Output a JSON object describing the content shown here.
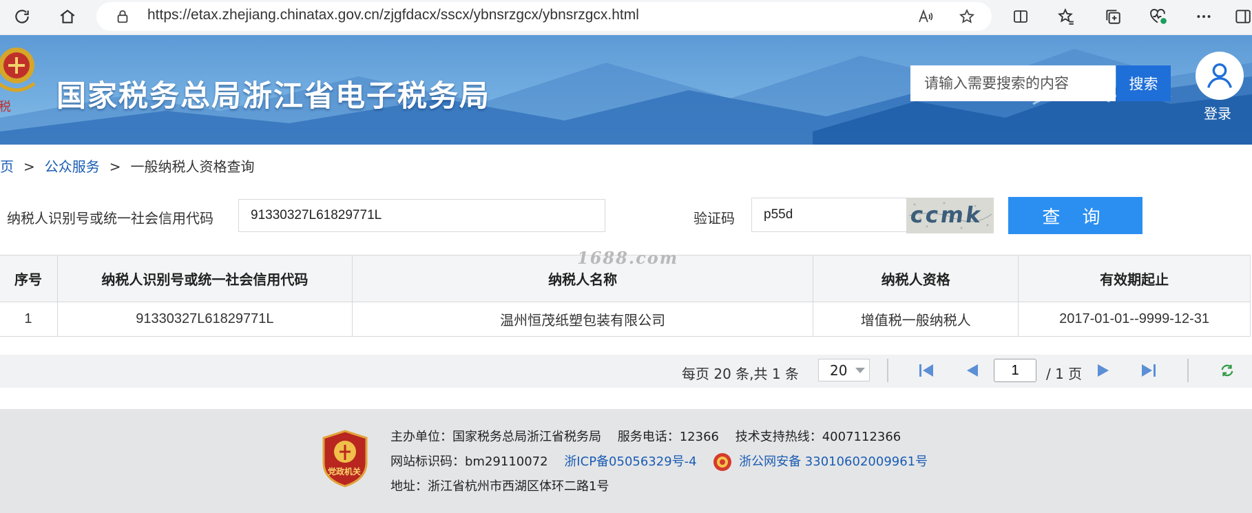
{
  "browser": {
    "url": "https://etax.zhejiang.chinatax.gov.cn/zjgfdacx/sscx/ybnsrzgcx/ybnsrzgcx.html"
  },
  "header": {
    "site_title": "国家税务总局浙江省电子税务局",
    "search_placeholder": "请输入需要搜索的内容",
    "search_button": "搜索",
    "login_label": "登录"
  },
  "breadcrumb": {
    "home": "首页",
    "separator": ">",
    "public_service": "公众服务",
    "current": "一般纳税人资格查询"
  },
  "query": {
    "taxpayer_id_label": "纳税人识别号或统一社会信用代码",
    "taxpayer_id_value": "91330327L61829771L",
    "captcha_label": "验证码",
    "captcha_value": "p55d",
    "captcha_image_text": "ccmk",
    "submit_button": "查 询"
  },
  "watermark": "1688.com",
  "table": {
    "columns": [
      "序号",
      "纳税人识别号或统一社会信用代码",
      "纳税人名称",
      "纳税人资格",
      "有效期起止"
    ],
    "rows": [
      [
        "1",
        "91330327L61829771L",
        "温州恒茂纸塑包装有限公司",
        "增值税一般纳税人",
        "2017-01-01--9999-12-31"
      ]
    ]
  },
  "pagination": {
    "summary": "每页 20 条,共 1 条",
    "page_size": "20",
    "current_page": "1",
    "total_pages": "/ 1 页"
  },
  "footer": {
    "host_label": "主办单位：国家税务总局浙江省税务局",
    "service_phone": "服务电话：12366",
    "tech_hotline": "技术支持热线：4007112366",
    "site_code": "网站标识码：bm29110072",
    "icp": "浙ICP备05056329号-4",
    "police_record": "浙公网安备 33010602009961号",
    "address": "地址：浙江省杭州市西湖区体环二路1号",
    "badge_text": "党政机关"
  },
  "colors": {
    "accent": "#2b8ff2",
    "search_button": "#1f6fd9",
    "link": "#1a5cb3",
    "banner": "#4f8fd1"
  },
  "icons": [
    "refresh-icon",
    "home-icon",
    "site-info-icon",
    "read-aloud-icon",
    "favorite-star-icon",
    "split-screen-icon",
    "favorites-icon",
    "collections-icon",
    "browser-essentials-icon",
    "more-icon",
    "user-icon",
    "first-page-icon",
    "prev-page-icon",
    "next-page-icon",
    "last-page-icon",
    "reload-icon",
    "police-emblem-icon"
  ]
}
